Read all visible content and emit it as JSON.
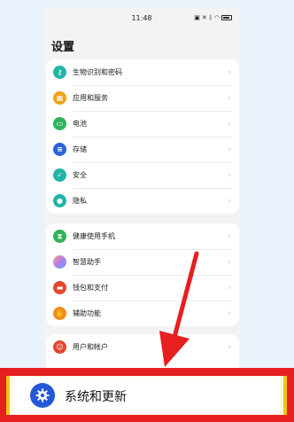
{
  "status": {
    "time": "11:48"
  },
  "header": {
    "title": "设置"
  },
  "groups": [
    {
      "items": [
        {
          "label": "生物识别和密码",
          "icon": "key-icon",
          "color": "#22b5a6"
        },
        {
          "label": "应用和服务",
          "icon": "apps-icon",
          "color": "#f2a21a"
        },
        {
          "label": "电池",
          "icon": "battery-icon",
          "color": "#2fb35a"
        },
        {
          "label": "存储",
          "icon": "storage-icon",
          "color": "#2b63d9"
        },
        {
          "label": "安全",
          "icon": "shield-icon",
          "color": "#22b5a6"
        },
        {
          "label": "隐私",
          "icon": "privacy-icon",
          "color": "#22b5a6"
        }
      ]
    },
    {
      "items": [
        {
          "label": "健康使用手机",
          "icon": "hourglass-icon",
          "color": "#2fb35a"
        },
        {
          "label": "智慧助手",
          "icon": "assistant-icon",
          "color": "#b57cf0"
        },
        {
          "label": "钱包和支付",
          "icon": "wallet-icon",
          "color": "#e4462e"
        },
        {
          "label": "辅助功能",
          "icon": "accessibility-icon",
          "color": "#f28c1a"
        }
      ]
    },
    {
      "items": [
        {
          "label": "用户和帐户",
          "icon": "user-icon",
          "color": "#e4462e"
        }
      ]
    }
  ],
  "highlight": {
    "label": "系统和更新",
    "icon": "gear-icon",
    "color": "#2358d8"
  },
  "colors": {
    "banner": "#e61f1f",
    "arrow": "#e61f1f",
    "accent": "#2358d8"
  }
}
